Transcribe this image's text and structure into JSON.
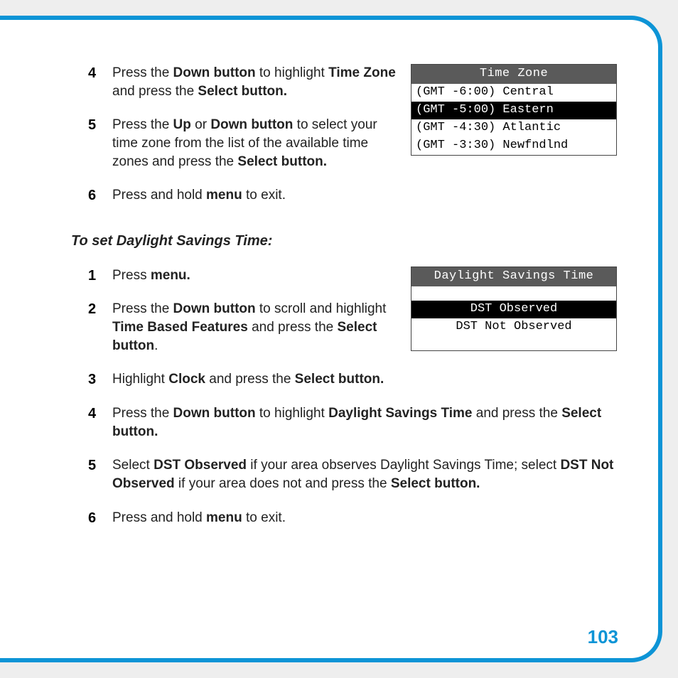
{
  "page_number": "103",
  "steps_a": [
    {
      "num": "4",
      "pre": "Press the ",
      "b1": "Down button",
      "mid": " to highlight ",
      "b2": "Time Zone",
      "mid2": " and press the ",
      "b3": "Select button."
    },
    {
      "num": "5",
      "pre": "Press the ",
      "b1": "Up",
      "or": " or ",
      "b2": "Down button",
      "mid": " to select your time zone from the list of the available time zones and press the ",
      "b3": "Select button."
    },
    {
      "num": "6",
      "pre": "Press and hold ",
      "b1": "menu",
      "post": " to exit."
    }
  ],
  "section_heading": "To set Daylight Savings Time:",
  "steps_b": [
    {
      "num": "1",
      "pre": "Press ",
      "b1": "menu."
    },
    {
      "num": "2",
      "pre": "Press the ",
      "b1": "Down button",
      "mid": " to scroll and highlight ",
      "b2": "Time Based Features",
      "mid2": " and press the ",
      "b3": "Select button",
      "post": "."
    },
    {
      "num": "3",
      "pre": "Highlight ",
      "b1": "Clock",
      "mid": " and press the ",
      "b2": "Select button."
    },
    {
      "num": "4",
      "pre": "Press the ",
      "b1": "Down button",
      "mid": " to highlight ",
      "b2": "Daylight Savings Time",
      "mid2": " and press the ",
      "b3": "Select button."
    },
    {
      "num": "5",
      "pre": "Select ",
      "b1": "DST Observed",
      "mid": " if your area observes Daylight Savings Time; select ",
      "b2": "DST Not Observed",
      "mid2": " if your area does not and press the ",
      "b3": "Select button."
    },
    {
      "num": "6",
      "pre": "Press and hold ",
      "b1": "menu",
      "post": " to exit."
    }
  ],
  "screen_timezone": {
    "title": "Time Zone",
    "rows": [
      {
        "text": "(GMT -6:00) Central",
        "selected": false
      },
      {
        "text": "(GMT -5:00) Eastern",
        "selected": true
      },
      {
        "text": "(GMT -4:30) Atlantic",
        "selected": false
      },
      {
        "text": "(GMT -3:30) Newfndlnd",
        "selected": false
      }
    ]
  },
  "screen_dst": {
    "title": "Daylight Savings Time",
    "rows": [
      {
        "text": "DST Observed",
        "selected": true
      },
      {
        "text": "DST Not Observed",
        "selected": false
      }
    ]
  }
}
